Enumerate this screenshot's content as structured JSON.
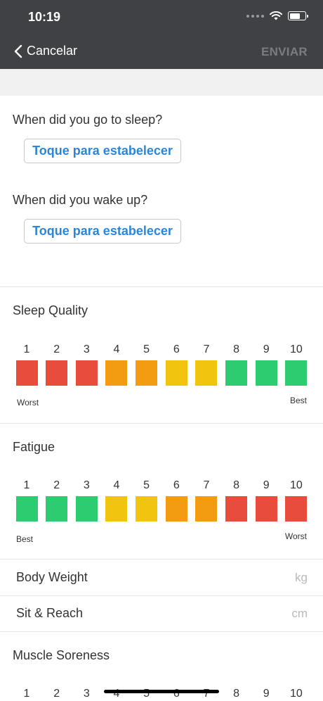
{
  "status_bar": {
    "time": "10:19",
    "battery_level": 0.7
  },
  "nav": {
    "back_label": "Cancelar",
    "send_label": "ENVIAR"
  },
  "sleep_times": {
    "sleep_question": "When did you go to sleep?",
    "sleep_button": "Toque para estabelecer",
    "wake_question": "When did you wake up?",
    "wake_button": "Toque para estabelecer"
  },
  "sleep_quality": {
    "title": "Sleep Quality",
    "low_label": "Worst",
    "high_label": "Best",
    "options": [
      {
        "label": "1",
        "color": "#e74c3c"
      },
      {
        "label": "2",
        "color": "#e74c3c"
      },
      {
        "label": "3",
        "color": "#e74c3c"
      },
      {
        "label": "4",
        "color": "#f39c12"
      },
      {
        "label": "5",
        "color": "#f39c12"
      },
      {
        "label": "6",
        "color": "#f1c40f"
      },
      {
        "label": "7",
        "color": "#f1c40f"
      },
      {
        "label": "8",
        "color": "#2ecc71"
      },
      {
        "label": "9",
        "color": "#2ecc71"
      },
      {
        "label": "10",
        "color": "#2ecc71"
      }
    ]
  },
  "fatigue": {
    "title": "Fatigue",
    "low_label": "Best",
    "high_label": "Worst",
    "options": [
      {
        "label": "1",
        "color": "#2ecc71"
      },
      {
        "label": "2",
        "color": "#2ecc71"
      },
      {
        "label": "3",
        "color": "#2ecc71"
      },
      {
        "label": "4",
        "color": "#f1c40f"
      },
      {
        "label": "5",
        "color": "#f1c40f"
      },
      {
        "label": "6",
        "color": "#f39c12"
      },
      {
        "label": "7",
        "color": "#f39c12"
      },
      {
        "label": "8",
        "color": "#e74c3c"
      },
      {
        "label": "9",
        "color": "#e74c3c"
      },
      {
        "label": "10",
        "color": "#e74c3c"
      }
    ]
  },
  "body_weight": {
    "label": "Body Weight",
    "unit": "kg"
  },
  "sit_reach": {
    "label": "Sit & Reach",
    "unit": "cm"
  },
  "muscle_soreness": {
    "title": "Muscle Soreness",
    "options": [
      {
        "label": "1"
      },
      {
        "label": "2"
      },
      {
        "label": "3"
      },
      {
        "label": "4"
      },
      {
        "label": "5"
      },
      {
        "label": "6"
      },
      {
        "label": "7"
      },
      {
        "label": "8"
      },
      {
        "label": "9"
      },
      {
        "label": "10"
      }
    ]
  }
}
